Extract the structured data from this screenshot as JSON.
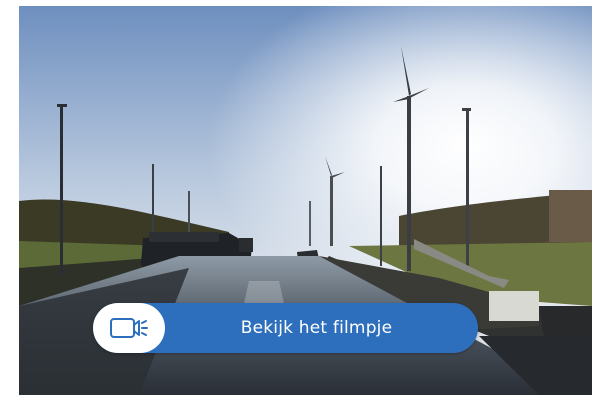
{
  "video": {
    "cta_label": "Bekijk het filmpje",
    "icon": "video-camera-icon",
    "accent_color": "#2e6fbd"
  }
}
